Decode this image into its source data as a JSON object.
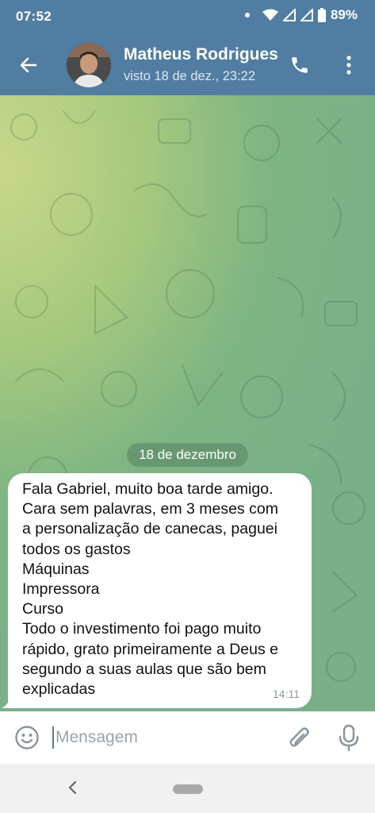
{
  "status_bar": {
    "time": "07:52",
    "battery": "89%"
  },
  "header": {
    "contact_name": "Matheus Rodrigues",
    "last_seen": "visto 18 de dez., 23:22"
  },
  "chat": {
    "date_separator": "18 de dezembro",
    "message": {
      "lines": [
        "Fala Gabriel, muito boa tarde amigo.",
        "Cara sem palavras, em 3 meses com",
        "a personalização de canecas, paguei",
        "todos os gastos",
        "Máquinas",
        "Impressora",
        "Curso",
        "Todo o investimento foi pago muito",
        "rápido, grato primeiramente a Deus e",
        "segundo a suas aulas que são bem",
        "explicadas"
      ],
      "time": "14:11"
    }
  },
  "composer": {
    "placeholder": "Mensagem"
  },
  "colors": {
    "header": "#517da2",
    "bubble": "#ffffff",
    "chat_bg": "#8fbf80"
  },
  "icons": [
    "back-arrow-icon",
    "phone-icon",
    "more-vertical-icon",
    "emoji-icon",
    "paperclip-icon",
    "microphone-icon",
    "wifi-icon",
    "signal-icon",
    "battery-icon"
  ]
}
